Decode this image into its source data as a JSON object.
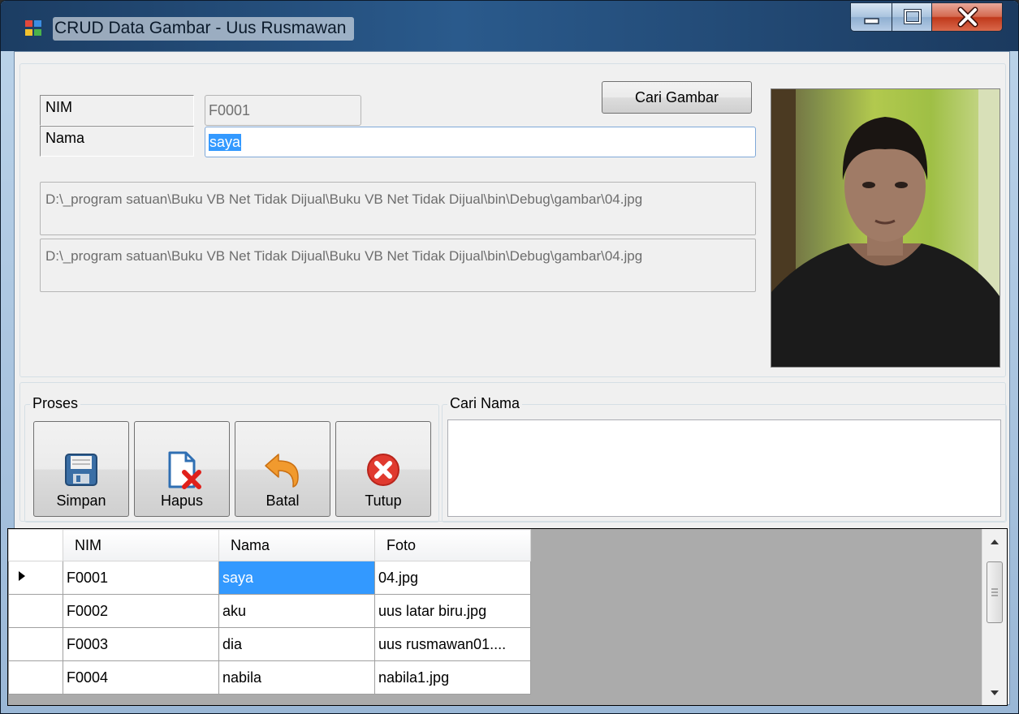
{
  "window": {
    "title": "CRUD Data Gambar - Uus Rusmawan",
    "controls": {
      "minimize": "minimize-icon",
      "maximize": "maximize-icon",
      "close": "close-icon"
    }
  },
  "form": {
    "nim_label": "NIM",
    "nim_value": "F0001",
    "nama_label": "Nama",
    "nama_value": "saya",
    "path1": "D:\\_program satuan\\Buku VB Net Tidak Dijual\\Buku VB Net Tidak Dijual\\bin\\Debug\\gambar\\04.jpg",
    "path2": "D:\\_program satuan\\Buku VB Net Tidak Dijual\\Buku VB Net Tidak Dijual\\bin\\Debug\\gambar\\04.jpg",
    "cari_gambar_label": "Cari Gambar"
  },
  "proses": {
    "title": "Proses",
    "buttons": [
      {
        "label": "Simpan",
        "icon": "floppy-disk-icon"
      },
      {
        "label": "Hapus",
        "icon": "delete-file-icon"
      },
      {
        "label": "Batal",
        "icon": "undo-arrow-icon"
      },
      {
        "label": "Tutup",
        "icon": "close-circle-icon"
      }
    ]
  },
  "cari_nama": {
    "title": "Cari Nama",
    "value": ""
  },
  "grid": {
    "columns": [
      "NIM",
      "Nama",
      "Foto"
    ],
    "rows": [
      {
        "nim": "F0001",
        "nama": "saya",
        "foto": "04.jpg"
      },
      {
        "nim": "F0002",
        "nama": "aku",
        "foto": "uus latar biru.jpg"
      },
      {
        "nim": "F0003",
        "nama": "dia",
        "foto": "uus rusmawan01...."
      },
      {
        "nim": "F0004",
        "nama": "nabila",
        "foto": "nabila1.jpg"
      }
    ],
    "current_row_icon": "row-pointer-icon"
  },
  "colors": {
    "selection": "#3399ff",
    "titlebar": "#2a5a8c",
    "close_button": "#c0391b"
  }
}
